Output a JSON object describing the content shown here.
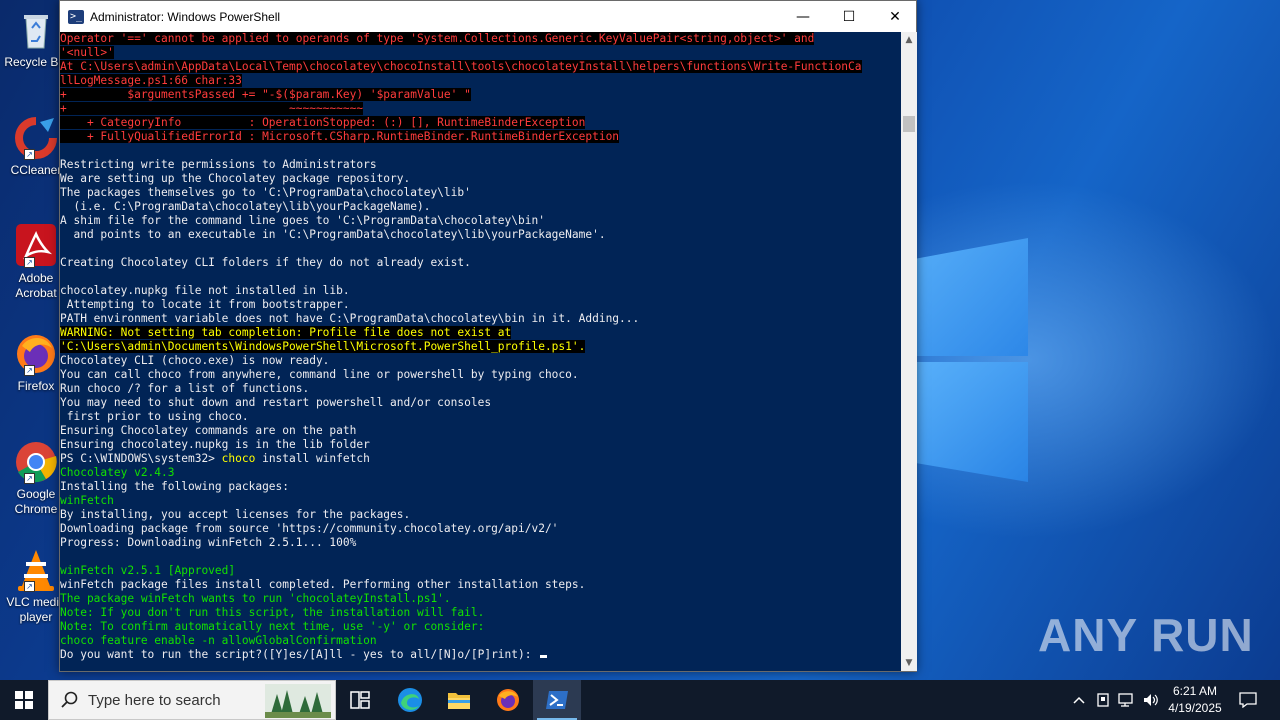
{
  "desktop": {
    "icons": [
      {
        "label": "Recycle Bin",
        "icon": "recycle-bin-icon"
      },
      {
        "label": "CCleaner",
        "icon": "ccleaner-icon"
      },
      {
        "label": "Adobe Acrobat",
        "icon": "adobe-acrobat-icon"
      },
      {
        "label": "Firefox",
        "icon": "firefox-icon"
      },
      {
        "label": "Google Chrome",
        "icon": "chrome-icon"
      },
      {
        "label": "VLC media player",
        "icon": "vlc-icon"
      }
    ],
    "watermark": "ANY RUN"
  },
  "window": {
    "title": "Administrator: Windows PowerShell",
    "controls": {
      "minimize": "—",
      "maximize": "☐",
      "close": "✕"
    }
  },
  "console": {
    "lines": [
      "Operator '==' cannot be applied to operands of type 'System.Collections.Generic.KeyValuePair<string,object>' and",
      "'<null>'",
      "At C:\\Users\\admin\\AppData\\Local\\Temp\\chocolatey\\chocoInstall\\tools\\chocolateyInstall\\helpers\\functions\\Write-FunctionCa",
      "llLogMessage.ps1:66 char:33",
      "+         $argumentsPassed += \"-$($param.Key) '$paramValue' \"",
      "+                                 ~~~~~~~~~~~",
      "    + CategoryInfo          : OperationStopped: (:) [], RuntimeBinderException",
      "    + FullyQualifiedErrorId : Microsoft.CSharp.RuntimeBinder.RuntimeBinderException",
      "",
      "Restricting write permissions to Administrators",
      "We are setting up the Chocolatey package repository.",
      "The packages themselves go to 'C:\\ProgramData\\chocolatey\\lib'",
      "  (i.e. C:\\ProgramData\\chocolatey\\lib\\yourPackageName).",
      "A shim file for the command line goes to 'C:\\ProgramData\\chocolatey\\bin'",
      "  and points to an executable in 'C:\\ProgramData\\chocolatey\\lib\\yourPackageName'.",
      "",
      "Creating Chocolatey CLI folders if they do not already exist.",
      "",
      "chocolatey.nupkg file not installed in lib.",
      " Attempting to locate it from bootstrapper.",
      "PATH environment variable does not have C:\\ProgramData\\chocolatey\\bin in it. Adding...",
      "WARNING: Not setting tab completion: Profile file does not exist at",
      "'C:\\Users\\admin\\Documents\\WindowsPowerShell\\Microsoft.PowerShell_profile.ps1'.",
      "Chocolatey CLI (choco.exe) is now ready.",
      "You can call choco from anywhere, command line or powershell by typing choco.",
      "Run choco /? for a list of functions.",
      "You may need to shut down and restart powershell and/or consoles",
      " first prior to using choco.",
      "Ensuring Chocolatey commands are on the path",
      "Ensuring chocolatey.nupkg is in the lib folder",
      "PS C:\\WINDOWS\\system32> ",
      "Chocolatey v2.4.3",
      "Installing the following packages:",
      "winFetch",
      "By installing, you accept licenses for the packages.",
      "Downloading package from source 'https://community.chocolatey.org/api/v2/'",
      "Progress: Downloading winFetch 2.5.1... 100%",
      "",
      "winFetch v2.5.1 [Approved]",
      "winFetch package files install completed. Performing other installation steps.",
      "The package winFetch wants to run 'chocolateyInstall.ps1'.",
      "Note: If you don't run this script, the installation will fail.",
      "Note: To confirm automatically next time, use '-y' or consider:",
      "choco feature enable -n allowGlobalConfirmation",
      "Do you want to run the script?([Y]es/[A]ll - yes to all/[N]o/[P]rint): "
    ],
    "command_keyword": "choco",
    "command_args": " install winfetch"
  },
  "taskbar": {
    "search_placeholder": "Type here to search",
    "apps": [
      "task-view-icon",
      "edge-icon",
      "file-explorer-icon",
      "firefox-icon",
      "powershell-icon"
    ],
    "clock": {
      "time": "6:21 AM",
      "date": "4/19/2025"
    }
  },
  "colors": {
    "console_bg": "#012456",
    "error_fg": "#ff3c3c",
    "warning_fg": "#ffff00",
    "success_fg": "#13e000"
  }
}
